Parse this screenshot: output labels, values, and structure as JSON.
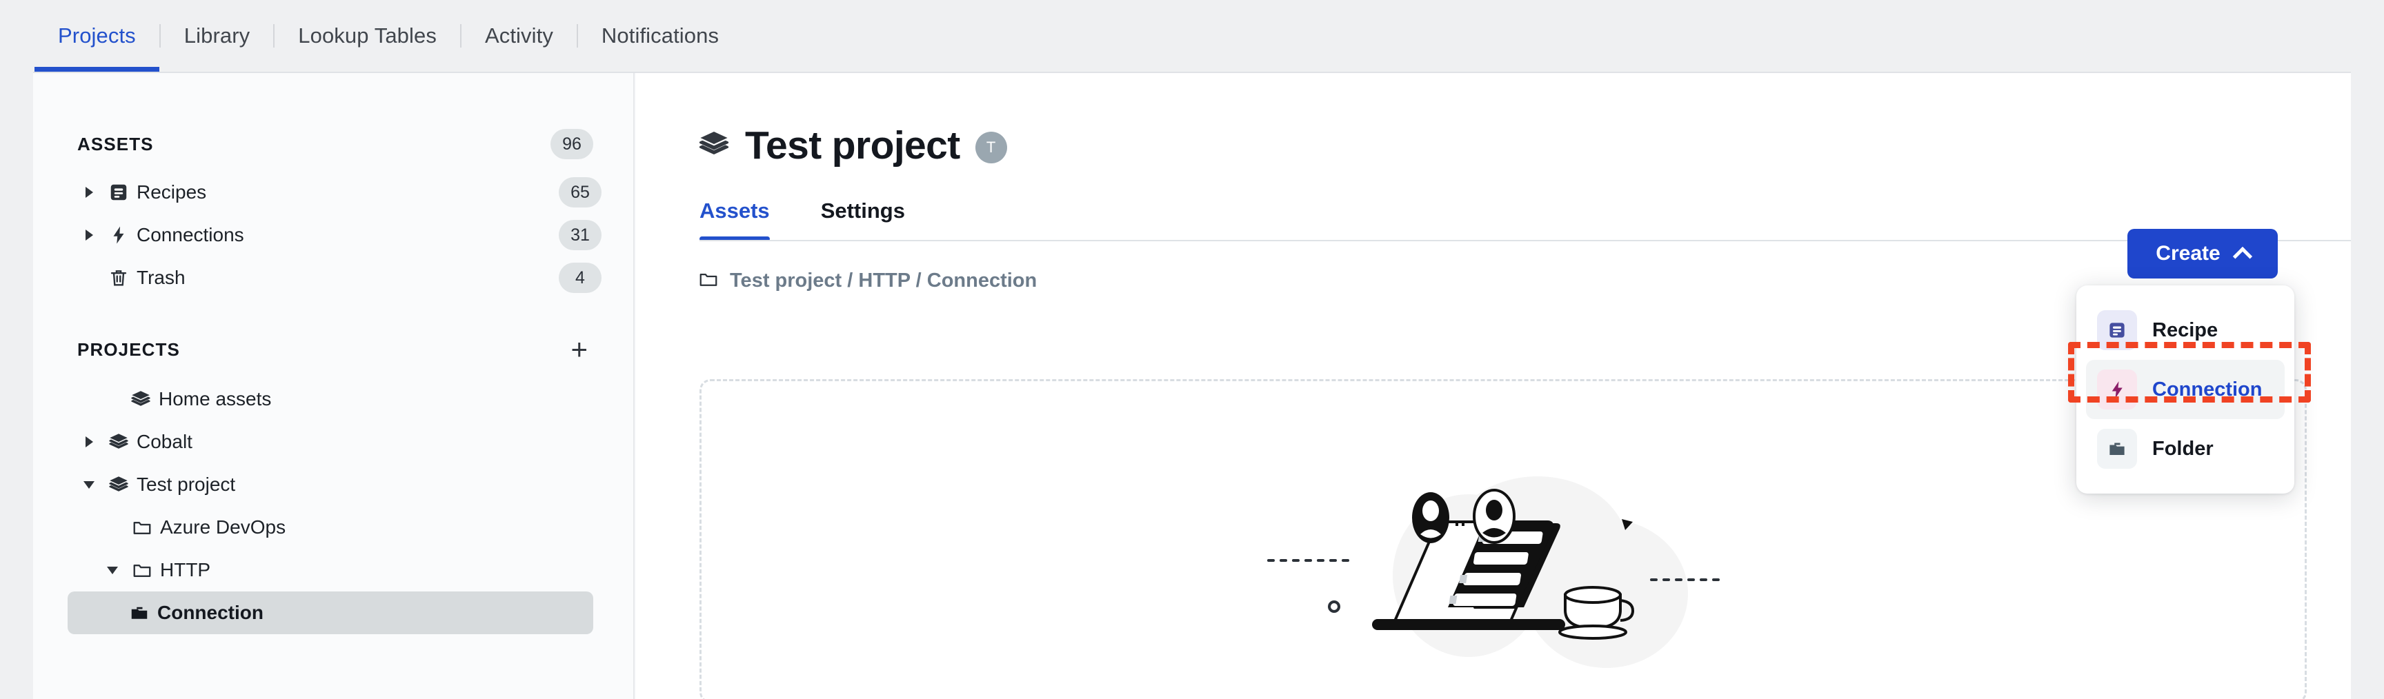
{
  "topnav": {
    "tabs": [
      {
        "label": "Projects",
        "active": true
      },
      {
        "label": "Library",
        "active": false
      },
      {
        "label": "Lookup Tables",
        "active": false
      },
      {
        "label": "Activity",
        "active": false
      },
      {
        "label": "Notifications",
        "active": false
      }
    ]
  },
  "sidebar": {
    "assets": {
      "title": "ASSETS",
      "count": "96",
      "items": [
        {
          "label": "Recipes",
          "count": "65",
          "icon": "recipe-icon",
          "caret": "right"
        },
        {
          "label": "Connections",
          "count": "31",
          "icon": "lightning-icon",
          "caret": "right"
        },
        {
          "label": "Trash",
          "count": "4",
          "icon": "trash-icon",
          "caret": "none"
        }
      ]
    },
    "projects": {
      "title": "PROJECTS",
      "add_label": "+",
      "items": [
        {
          "label": "Home assets",
          "icon": "layers-icon",
          "caret": "none",
          "indent": 0,
          "selected": false
        },
        {
          "label": "Cobalt",
          "icon": "layers-icon",
          "caret": "right",
          "indent": 0,
          "selected": false
        },
        {
          "label": "Test project",
          "icon": "layers-icon",
          "caret": "down",
          "indent": 0,
          "selected": false
        },
        {
          "label": "Azure DevOps",
          "icon": "folder-outline-icon",
          "caret": "none",
          "indent": 1,
          "selected": false
        },
        {
          "label": "HTTP",
          "icon": "folder-outline-icon",
          "caret": "down",
          "indent": 1,
          "selected": false
        },
        {
          "label": "Connection",
          "icon": "folder-filled-icon",
          "caret": "none",
          "indent": 2,
          "selected": true
        }
      ]
    }
  },
  "content": {
    "page_title": "Test project",
    "avatar_initial": "T",
    "tabs": [
      {
        "label": "Assets",
        "active": true
      },
      {
        "label": "Settings",
        "active": false
      }
    ],
    "breadcrumb": "Test project / HTTP / Connection",
    "create": {
      "label": "Create",
      "menu": [
        {
          "label": "Recipe",
          "icon": "recipe-icon",
          "hovered": false
        },
        {
          "label": "Connection",
          "icon": "lightning-icon",
          "hovered": true
        },
        {
          "label": "Folder",
          "icon": "folder-filled-icon",
          "hovered": false
        }
      ]
    }
  },
  "colors": {
    "accent": "#2351cc",
    "create_button": "#1f46cc",
    "annotation": "#f04323",
    "page_bg": "#eff0f2",
    "panel_bg": "#fafbfc",
    "selected_row": "#d7dbdd",
    "badge_bg": "#dfe3e5",
    "avatar_bg": "#9aa7b0",
    "breadcrumb_text": "#6c7b8a"
  }
}
